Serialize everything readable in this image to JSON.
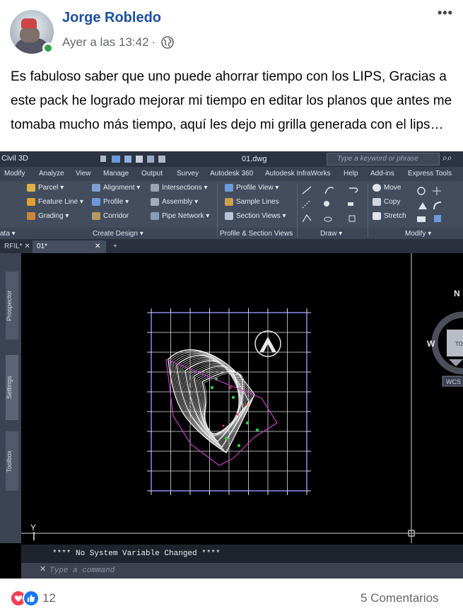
{
  "post": {
    "author": "Jorge Robledo",
    "timestamp": "Ayer a las 13:42",
    "separator": "·",
    "more_label": "•••",
    "text": "Es fabuloso saber que uno puede ahorrar tiempo con los LIPS, Gracias a este pack he logrado mejorar mi tiempo en editar los planos que antes me tomaba mucho más tiempo, aquí les dejo mi grilla generada con el lips…"
  },
  "autocad": {
    "app_title": "Civil 3D",
    "file_name": "01.dwg",
    "search_placeholder": "Type a keyword or phrase",
    "menu": [
      "Modify",
      "Analyze",
      "View",
      "Manage",
      "Output",
      "Survey",
      "Autodesk 360",
      "Autodesk InfraWorks",
      "Help",
      "Add-ins",
      "Express Tools"
    ],
    "ribbon": {
      "create_design": [
        "Parcel ▾",
        "Feature Line ▾",
        "Grading ▾",
        "Alignment ▾",
        "Profile ▾",
        "Corridor",
        "Intersections ▾",
        "Assembly ▾",
        "Pipe Network ▾"
      ],
      "profile_section": [
        "Profile View ▾",
        "Sample Lines",
        "Section Views ▾"
      ],
      "modify": [
        "Move",
        "Copy",
        "Stretch"
      ],
      "panel_labels": {
        "left": "ata ▾",
        "create_design": "Create Design ▾",
        "profile_section": "Profile & Section Views",
        "draw": "Draw ▾",
        "modify": "Modify ▾"
      }
    },
    "tabs": [
      "RFIL*",
      "01*"
    ],
    "side_panels": [
      "Prospector",
      "Settings",
      "Toolbox"
    ],
    "viewcube": {
      "north": "N",
      "west": "W",
      "top": "TOP",
      "wcs": "WCS"
    },
    "y_axis": "Y",
    "command_output": "**** No System Variable Changed ****",
    "command_placeholder": "Type a command"
  },
  "footer": {
    "reaction_count": "12",
    "comments": "5 Comentarios"
  },
  "colors": {
    "author": "#1c4ea0",
    "online": "#31a24c",
    "love": "#f33e58",
    "like": "#1877f2",
    "contour": "#e8e8e8",
    "boundary": "#c040c0",
    "green_markers": "#30d040",
    "red_detail": "#e03030"
  }
}
